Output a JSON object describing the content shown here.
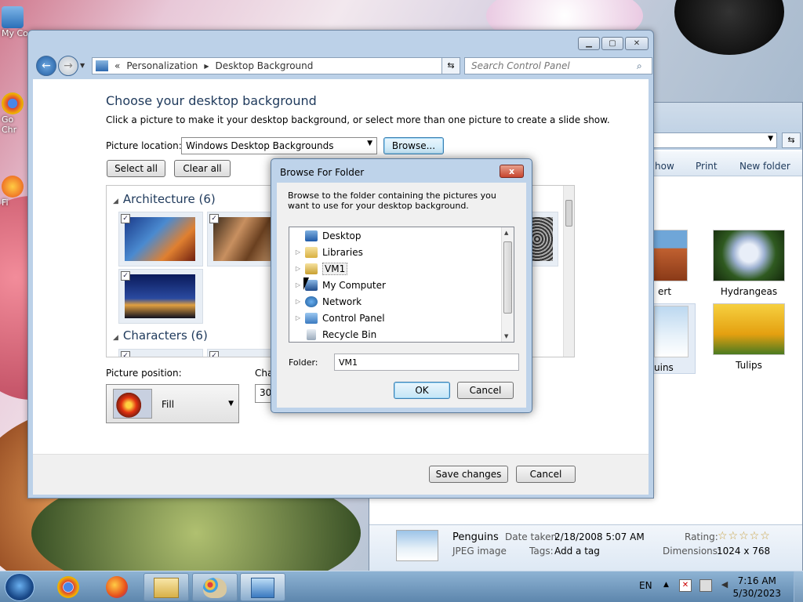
{
  "desktop": {
    "icons": [
      {
        "label": "My Co",
        "icon": "computer-icon"
      },
      {
        "label": "Go Chr",
        "icon": "chrome-shortcut-icon"
      },
      {
        "label": "Fi",
        "icon": "firefox-shortcut-icon"
      }
    ]
  },
  "explorer_bg": {
    "commands": [
      "how",
      "Print",
      "New folder"
    ],
    "tiles": [
      {
        "label": "ert"
      },
      {
        "label": "Hydrangeas"
      },
      {
        "label": "uins"
      },
      {
        "label": "Tulips"
      }
    ],
    "details": {
      "name": "Penguins",
      "type": "JPEG image",
      "date_label": "Date taken:",
      "date_value": "2/18/2008 5:07 AM",
      "tags_label": "Tags:",
      "tags_value": "Add a tag",
      "rating_label": "Rating:",
      "rating_stars": "☆☆☆☆☆",
      "rating_value": 0,
      "dims_label": "Dimensions:",
      "dims_value": "1024 x 768"
    }
  },
  "window": {
    "breadcrumb": [
      "Personalization",
      "Desktop Background"
    ],
    "breadcrumb_prefix": "«",
    "search_placeholder": "Search Control Panel",
    "title": "Choose your desktop background",
    "subtitle": "Click a picture to make it your desktop background, or select more than one picture to create a slide show.",
    "picture_location_label": "Picture location:",
    "picture_location_value": "Windows Desktop Backgrounds",
    "browse_label": "Browse...",
    "select_all_label": "Select all",
    "clear_all_label": "Clear all",
    "groups": [
      {
        "name": "Architecture (6)"
      },
      {
        "name": "Characters (6)"
      }
    ],
    "picture_position_label": "Picture position:",
    "picture_position_value": "Fill",
    "change_label": "Cha",
    "change_value": "30",
    "save_label": "Save changes",
    "cancel_label": "Cancel"
  },
  "dialog": {
    "title": "Browse For Folder",
    "close_glyph": "x",
    "description": "Browse to the folder containing the pictures you want to use for your desktop background.",
    "tree": [
      {
        "label": "Desktop",
        "icon": "desktop-icon",
        "expandable": false
      },
      {
        "label": "Libraries",
        "icon": "libraries-icon",
        "expandable": true
      },
      {
        "label": "VM1",
        "icon": "user-folder-icon",
        "expandable": true,
        "selected": true
      },
      {
        "label": "My Computer",
        "icon": "computer-icon",
        "expandable": true
      },
      {
        "label": "Network",
        "icon": "network-icon",
        "expandable": true
      },
      {
        "label": "Control Panel",
        "icon": "control-panel-icon",
        "expandable": true
      },
      {
        "label": "Recycle Bin",
        "icon": "recycle-bin-icon",
        "expandable": false
      }
    ],
    "folder_label": "Folder:",
    "folder_value": "VM1",
    "ok_label": "OK",
    "cancel_label": "Cancel"
  },
  "taskbar": {
    "language": "EN",
    "time": "7:16 AM",
    "date": "5/30/2023"
  },
  "colors": {
    "heading": "#1e395b",
    "selected_blue": "#3c7fb1"
  }
}
